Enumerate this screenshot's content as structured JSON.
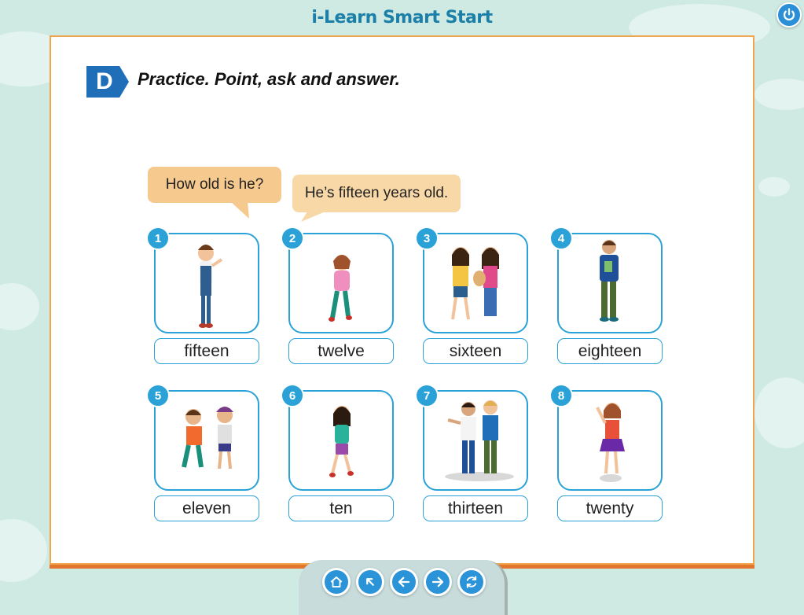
{
  "app": {
    "title": "i-Learn Smart Start"
  },
  "exercise": {
    "badge": "D",
    "instruction": "Practice. Point, ask and answer.",
    "question_bubble": "How old is he?",
    "answer_bubble": "He’s fifteen years old."
  },
  "items": [
    {
      "number": "1",
      "label": "fifteen"
    },
    {
      "number": "2",
      "label": "twelve"
    },
    {
      "number": "3",
      "label": "sixteen"
    },
    {
      "number": "4",
      "label": "eighteen"
    },
    {
      "number": "5",
      "label": "eleven"
    },
    {
      "number": "6",
      "label": "ten"
    },
    {
      "number": "7",
      "label": "thirteen"
    },
    {
      "number": "8",
      "label": "twenty"
    }
  ],
  "navigation": [
    {
      "icon": "home-icon"
    },
    {
      "icon": "back-arrow-icon"
    },
    {
      "icon": "previous-icon"
    },
    {
      "icon": "next-icon"
    },
    {
      "icon": "refresh-icon"
    }
  ],
  "colors": {
    "accent": "#2aa2d8",
    "bubble": "#f6c98e",
    "border": "#f0a64e",
    "badge": "#1f6fb8"
  }
}
